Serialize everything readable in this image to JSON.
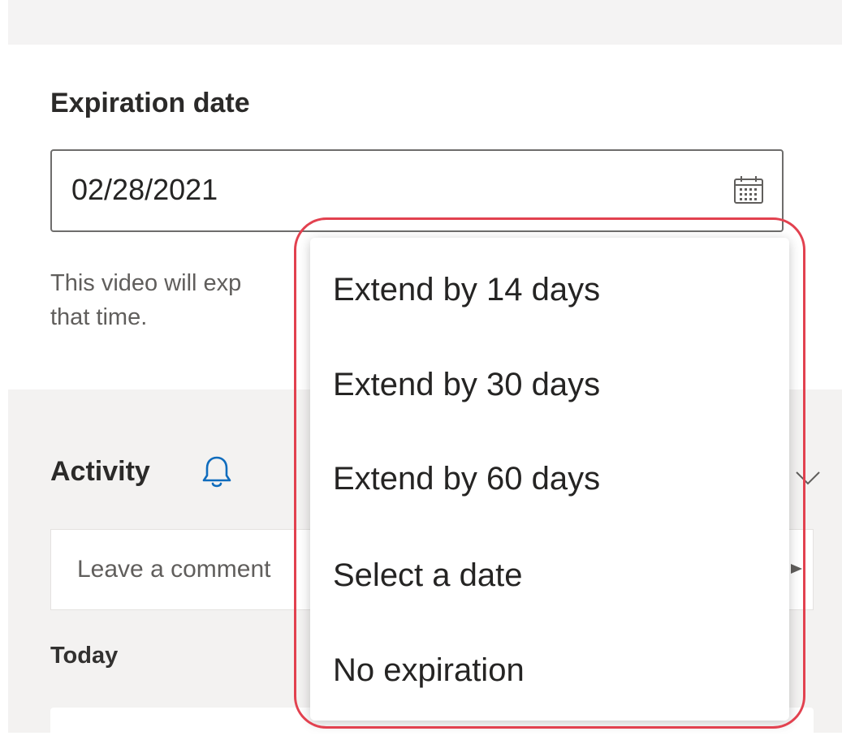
{
  "expiration": {
    "title": "Expiration date",
    "date_value": "02/28/2021",
    "help_text_line1": "This video will exp",
    "help_text_line2": "that time."
  },
  "activity": {
    "title": "Activity",
    "comment_placeholder": "Leave a comment",
    "today_label": "Today"
  },
  "dropdown": {
    "items": [
      {
        "label": "Extend by 14 days"
      },
      {
        "label": "Extend by 30 days"
      },
      {
        "label": "Extend by 60 days"
      },
      {
        "label": "Select a date"
      },
      {
        "label": "No expiration"
      }
    ]
  },
  "colors": {
    "accent": "#0f6cbd",
    "highlight": "#e2414f",
    "panel_bg": "#f3f2f1"
  },
  "icons": {
    "calendar": "calendar-icon",
    "bell": "bell-icon",
    "chevron": "chevron-down-icon",
    "send": "send-icon"
  }
}
